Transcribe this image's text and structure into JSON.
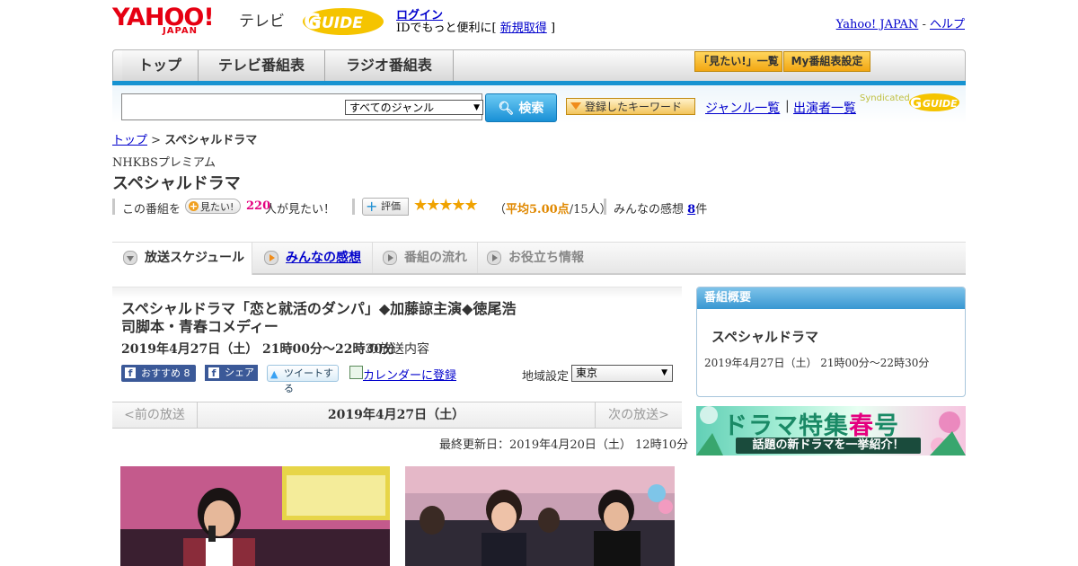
{
  "header": {
    "yahoo_logo": "YAHOO!",
    "yahoo_logo_sub": "JAPAN",
    "tv_label": "テレビ",
    "gguide_logo": "GUIDE",
    "login_label": "ログイン",
    "login_sub_prefix": "IDでもっと便利に[",
    "signup_label": "新規取得",
    "login_sub_suffix": "]",
    "yahoo_japan_link": "Yahoo! JAPAN",
    "link_sep": "-",
    "help_link": "ヘルプ"
  },
  "nav": {
    "tabs": [
      "トップ",
      "テレビ番組表",
      "ラジオ番組表"
    ],
    "want_list_btn": "「見たい!」一覧",
    "my_schedule_btn": "My番組表設定"
  },
  "search": {
    "input_value": "",
    "genre_selected": "すべてのジャンル",
    "search_btn": "検索",
    "keyword_btn": "登録したキーワード",
    "genre_list_link": "ジャンル一覧",
    "links_sep": "|",
    "performer_link": "出演者一覧",
    "syndicated_label": "Syndicated"
  },
  "breadcrumb": {
    "top": "トップ",
    "sep": ">",
    "current": "スペシャルドラマ"
  },
  "program": {
    "channel": "NHKBSプレミアム",
    "title": "スペシャルドラマ",
    "want_prefix": "この番組を",
    "want_btn": "見たい!",
    "want_count": "220",
    "want_suffix": "人が見たい！",
    "rate_btn": "評価",
    "stars": "★★★★★",
    "avg_open": "（",
    "avg_label": "平均5.00点",
    "avg_people": "/15人）",
    "review_label": "みんなの感想",
    "review_count": "8",
    "review_unit": "件"
  },
  "tabs": [
    {
      "label": "放送スケジュール",
      "active": true
    },
    {
      "label": "みんなの感想",
      "active": false
    },
    {
      "label": "番組の流れ",
      "active": false
    },
    {
      "label": "お役立ち情報",
      "active": false
    }
  ],
  "episode": {
    "title_line1": "スペシャルドラマ「恋と就活のダンパ」◆加藤諒主演◆徳尾浩",
    "title_line2": "司脚本・青春コメディー",
    "date": "2019年4月27日（土） 21時00分～22時30分",
    "date_suffix": "の放送内容",
    "fb_recommend": "おすすめ 8",
    "fb_share": "シェア",
    "tweet": "ツイートする",
    "calendar_link": "カレンダーに登録",
    "region_label": "地域設定",
    "region_selected": "東京"
  },
  "datenav": {
    "prev": "<前の放送",
    "current": "2019年4月27日（土）",
    "next": "次の放送>"
  },
  "updated": "最終更新日：2019年4月20日（土） 12時10分",
  "sidebar": {
    "summary_head": "番組概要",
    "summary_title": "スペシャルドラマ",
    "summary_date": "2019年4月27日（土） 21時00分～22時30分",
    "banner_title_a": "ドラマ特集",
    "banner_title_b": "春",
    "banner_title_c": "号",
    "banner_sub": "話題の新ドラマを一挙紹介！"
  },
  "colors": {
    "accent_blue": "#1793d1",
    "yahoo_red": "#e60012",
    "link": "#0000cc",
    "want_pink": "#e4007f",
    "star_gold": "#f0a200"
  }
}
